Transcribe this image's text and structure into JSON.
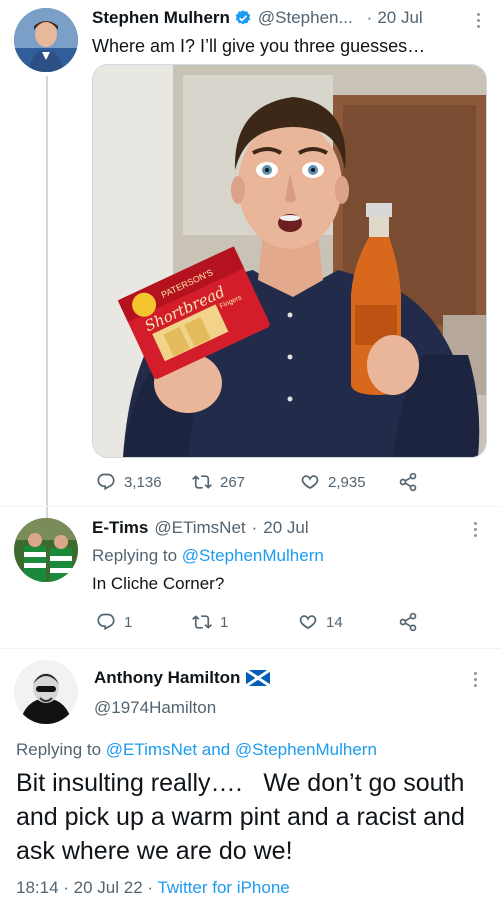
{
  "tweet1": {
    "name": "Stephen Mulhern",
    "handle": "@Stephen...",
    "dot": "·",
    "date": "20 Jul",
    "text": "Where am I? I’ll give you three guesses…",
    "image_text": {
      "box_brand": "PATERSON'S",
      "box_product": "Shortbread",
      "box_sub": "Fingers"
    },
    "replies": "3,136",
    "retweets": "267",
    "likes": "2,935"
  },
  "tweet2": {
    "name": "E-Tims",
    "handle": "@ETimsNet",
    "dot": "·",
    "date": "20 Jul",
    "replying_prefix": "Replying to",
    "replying_to": "@StephenMulhern",
    "text": "In Cliche Corner?",
    "replies": "1",
    "retweets": "1",
    "likes": "14"
  },
  "tweet3": {
    "name": "Anthony Hamilton",
    "handle": "@1974Hamilton",
    "replying_prefix": "Replying to",
    "replying_to_1": "@ETimsNet",
    "replying_and": "and",
    "replying_to_2": "@StephenMulhern",
    "text": "Bit insulting really….   We don’t go south and pick up a warm pint and a racist and ask where we are do we!",
    "timestamp": "18:14 · 20 Jul 22 ·",
    "source": "Twitter for iPhone"
  },
  "colors": {
    "accent": "#1d9bf0",
    "text": "#0f1419",
    "secondary": "#536471",
    "verified": "#1d9bf0"
  }
}
